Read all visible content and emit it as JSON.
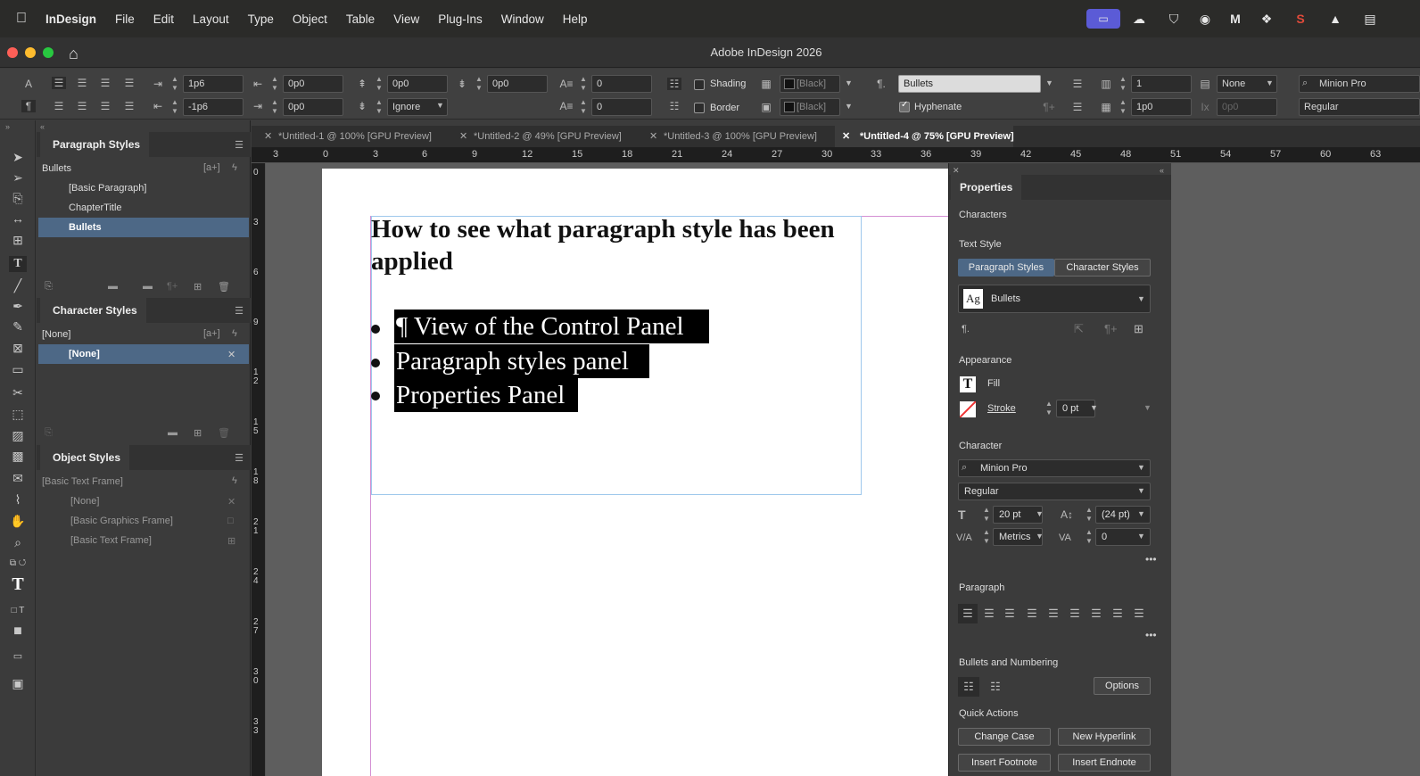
{
  "menubar": {
    "apple": "",
    "items": [
      "InDesign",
      "File",
      "Edit",
      "Layout",
      "Type",
      "Object",
      "Table",
      "View",
      "Plug-Ins",
      "Window",
      "Help"
    ],
    "tray_icons": [
      "screen-share-icon",
      "cloud-sync-icon",
      "shield-icon",
      "radar-icon",
      "malwarebytes-icon",
      "dropbox-icon",
      "s-app-icon",
      "drive-icon",
      "control-center-icon"
    ]
  },
  "window": {
    "title": "Adobe InDesign 2026"
  },
  "control_panel": {
    "left_indent": "1p6",
    "first_line_indent": "-1p6",
    "right_indent": "0p0",
    "last_line_indent": "0p0",
    "space_before": "0p0",
    "space_after_top": "0p0",
    "baseline_grid": "Ignore",
    "drop_cap_lines": "0",
    "drop_cap_chars": "0",
    "shading_label": "Shading",
    "border_label": "Border",
    "shading_swatch": "[Black]",
    "border_swatch": "[Black]",
    "paragraph_style": "Bullets",
    "hyphenate_label": "Hyphenate",
    "columns": "1",
    "column_gutter": "1p0",
    "span": "None",
    "span_value": "0p0",
    "font": "Minion Pro",
    "font_style": "Regular"
  },
  "paragraph_styles": {
    "title": "Paragraph Styles",
    "current": "Bullets",
    "items": [
      "[Basic Paragraph]",
      "ChapterTitle",
      "Bullets"
    ],
    "selected_index": 2
  },
  "character_styles": {
    "title": "Character Styles",
    "current": "[None]",
    "items": [
      "[None]"
    ]
  },
  "object_styles": {
    "title": "Object Styles",
    "current": "[Basic Text Frame]",
    "items": [
      "[None]",
      "[Basic Graphics Frame]",
      "[Basic Text Frame]"
    ]
  },
  "doc_tabs": [
    "*Untitled-1 @ 100% [GPU Preview]",
    "*Untitled-2 @ 49% [GPU Preview]",
    "*Untitled-3 @ 100% [GPU Preview]",
    "*Untitled-4 @ 75% [GPU Preview]"
  ],
  "ruler": {
    "h_ticks": [
      "3",
      "0",
      "3",
      "6",
      "9",
      "12",
      "15",
      "18",
      "21",
      "24",
      "27",
      "30",
      "33",
      "36",
      "39",
      "42",
      "45",
      "48",
      "51",
      "54",
      "57",
      "60",
      "63"
    ],
    "v_ticks": [
      "0",
      "3",
      "6",
      "9",
      "12",
      "15",
      "18",
      "21",
      "24",
      "27",
      "30",
      "33"
    ]
  },
  "document": {
    "heading_line1": "How to see what paragraph style has been",
    "heading_line2": "applied",
    "bullets": [
      "¶ View of the Control Panel",
      "Paragraph styles panel",
      "Properties Panel"
    ]
  },
  "properties": {
    "title": "Properties",
    "section_characters": "Characters",
    "text_style_label": "Text Style",
    "tab_paragraph": "Paragraph Styles",
    "tab_character": "Character Styles",
    "style_value": "Bullets",
    "style_icon": "Ag",
    "appearance_label": "Appearance",
    "fill_label": "Fill",
    "stroke_label": "Stroke",
    "stroke_weight": "0 pt",
    "character_label": "Character",
    "font": "Minion Pro",
    "font_style": "Regular",
    "font_size": "20 pt",
    "leading": "(24 pt)",
    "kerning": "Metrics",
    "tracking": "0",
    "paragraph_label": "Paragraph",
    "bullets_label": "Bullets and Numbering",
    "options_button": "Options",
    "quick_actions_label": "Quick Actions",
    "change_case": "Change Case",
    "new_hyperlink": "New Hyperlink",
    "insert_footnote": "Insert Footnote",
    "insert_endnote": "Insert Endnote"
  }
}
